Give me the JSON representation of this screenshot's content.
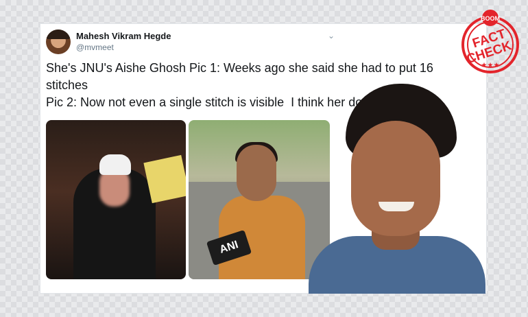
{
  "tweet": {
    "author_name": "Mahesh Vikram Hegde",
    "author_handle": "@mvmeet",
    "text": "She's JNU's Aishe Ghosh Pic 1: Weeks ago she said she had to put 16 stitches\nPic 2: Now not even a single stitch is visible  I think her doctor is God"
  },
  "photo2": {
    "mic_label": "ANI"
  },
  "stamp": {
    "brand": "BOOM",
    "line1": "FACT",
    "line2": "CHECK",
    "color": "#e3242b"
  },
  "icons": [
    "chevron-down-icon",
    "avatar",
    "fact-check-stamp-icon"
  ]
}
